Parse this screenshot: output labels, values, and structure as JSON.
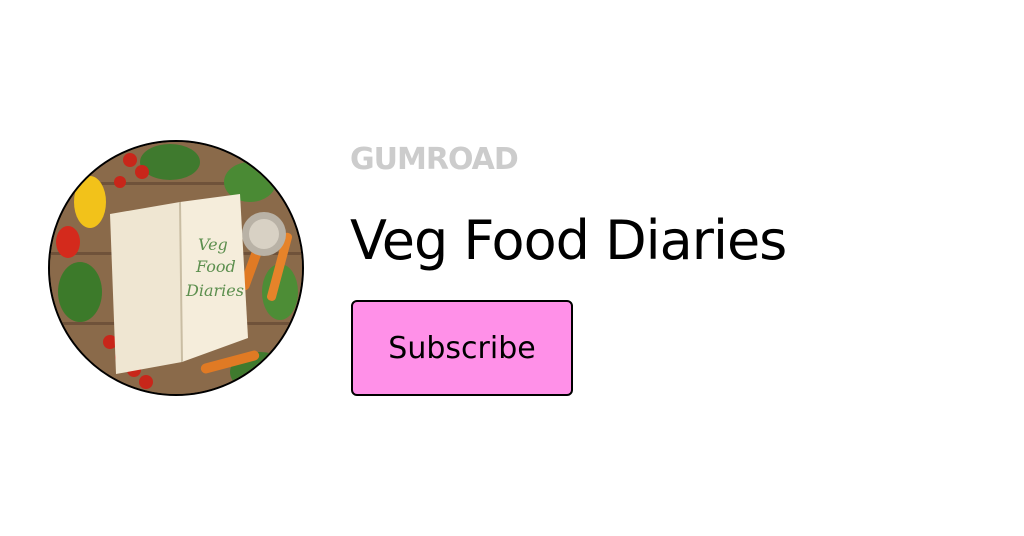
{
  "brand": {
    "logo_text": "GUMROAD",
    "logo_color": "#cccccc"
  },
  "profile": {
    "name": "Veg Food Diaries",
    "avatar_text": [
      "Veg",
      "Food",
      "Diaries"
    ]
  },
  "actions": {
    "subscribe_label": "Subscribe",
    "subscribe_color": "#ff90e8"
  }
}
